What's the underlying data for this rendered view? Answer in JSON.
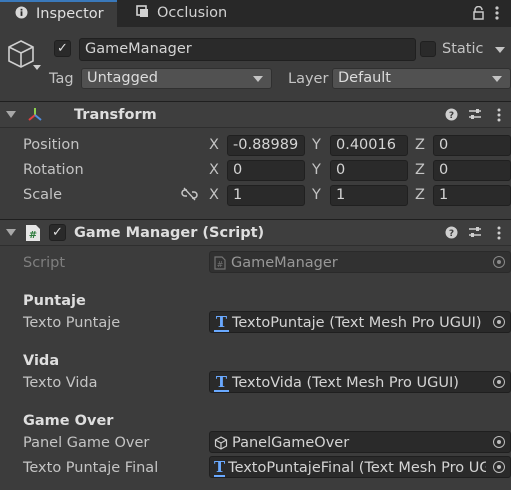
{
  "tabs": [
    {
      "label": "Inspector",
      "icon": "info-icon"
    },
    {
      "label": "Occlusion",
      "icon": "occlusion-icon"
    }
  ],
  "object": {
    "name": "GameManager",
    "active": true,
    "static_label": "Static",
    "tag_label": "Tag",
    "tag_value": "Untagged",
    "layer_label": "Layer",
    "layer_value": "Default"
  },
  "transform": {
    "title": "Transform",
    "rows": [
      {
        "label": "Position",
        "x": "-0.88989",
        "y": "0.40016",
        "z": "0"
      },
      {
        "label": "Rotation",
        "x": "0",
        "y": "0",
        "z": "0"
      },
      {
        "label": "Scale",
        "x": "1",
        "y": "1",
        "z": "1"
      }
    ],
    "axis_labels": [
      "X",
      "Y",
      "Z"
    ]
  },
  "script_component": {
    "title": "Game Manager (Script)",
    "enabled": true,
    "script_label": "Script",
    "script_value": "GameManager",
    "sections": [
      {
        "header": "Puntaje",
        "field_label": "Texto Puntaje",
        "field_value": "TextoPuntaje (Text Mesh Pro UGUI)"
      },
      {
        "header": "Vida",
        "field_label": "Texto Vida",
        "field_value": "TextoVida (Text Mesh Pro UGUI)"
      },
      {
        "header": "Game Over",
        "field_label": "Panel Game Over",
        "field_value": "PanelGameOver"
      }
    ],
    "final_label": "Texto Puntaje Final",
    "final_value": "TextoPuntajeFinal (Text Mesh Pro UGUI)"
  },
  "colors": {
    "panel": "#3c3c3c",
    "tabbar": "#282828",
    "accent": "#3a79bb",
    "tmp_icon": "#6aa9ff"
  }
}
